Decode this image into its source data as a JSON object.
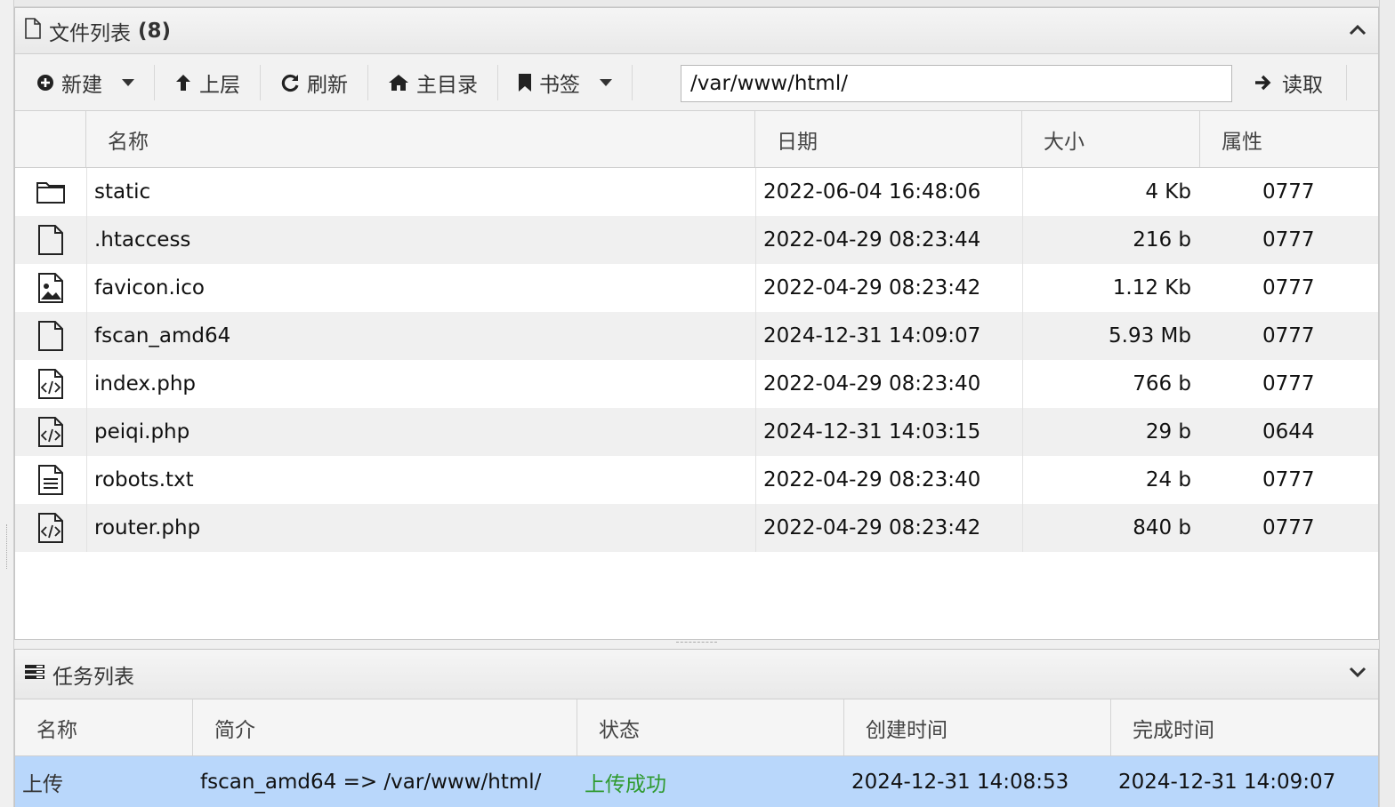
{
  "file_panel": {
    "title_label": "文件列表",
    "count": "(8)",
    "toolbar": {
      "new_label": "新建",
      "up_label": "上层",
      "refresh_label": "刷新",
      "home_label": "主目录",
      "bookmark_label": "书签",
      "path_value": "/var/www/html/",
      "read_label": "读取"
    },
    "columns": {
      "name": "名称",
      "date": "日期",
      "size": "大小",
      "attr": "属性"
    },
    "files": [
      {
        "name": "static",
        "date": "2022-06-04 16:48:06",
        "size": "4 Kb",
        "attr": "0777",
        "icon": "folder-icon"
      },
      {
        "name": ".htaccess",
        "date": "2022-04-29 08:23:44",
        "size": "216 b",
        "attr": "0777",
        "icon": "file-icon"
      },
      {
        "name": "favicon.ico",
        "date": "2022-04-29 08:23:42",
        "size": "1.12 Kb",
        "attr": "0777",
        "icon": "image-file-icon"
      },
      {
        "name": "fscan_amd64",
        "date": "2024-12-31 14:09:07",
        "size": "5.93 Mb",
        "attr": "0777",
        "icon": "file-icon"
      },
      {
        "name": "index.php",
        "date": "2022-04-29 08:23:40",
        "size": "766 b",
        "attr": "0777",
        "icon": "code-file-icon"
      },
      {
        "name": "peiqi.php",
        "date": "2024-12-31 14:03:15",
        "size": "29 b",
        "attr": "0644",
        "icon": "code-file-icon"
      },
      {
        "name": "robots.txt",
        "date": "2022-04-29 08:23:40",
        "size": "24 b",
        "attr": "0777",
        "icon": "text-file-icon"
      },
      {
        "name": "router.php",
        "date": "2022-04-29 08:23:42",
        "size": "840 b",
        "attr": "0777",
        "icon": "code-file-icon"
      }
    ]
  },
  "task_panel": {
    "title": "任务列表",
    "columns": {
      "name": "名称",
      "desc": "简介",
      "status": "状态",
      "created": "创建时间",
      "finished": "完成时间"
    },
    "tasks": [
      {
        "name": "上传",
        "desc": "fscan_amd64 => /var/www/html/",
        "status": "上传成功",
        "created": "2024-12-31 14:08:53",
        "finished": "2024-12-31 14:09:07"
      }
    ]
  },
  "colors": {
    "selected_row": "#b9d7fb",
    "success": "#2f9a2f"
  }
}
